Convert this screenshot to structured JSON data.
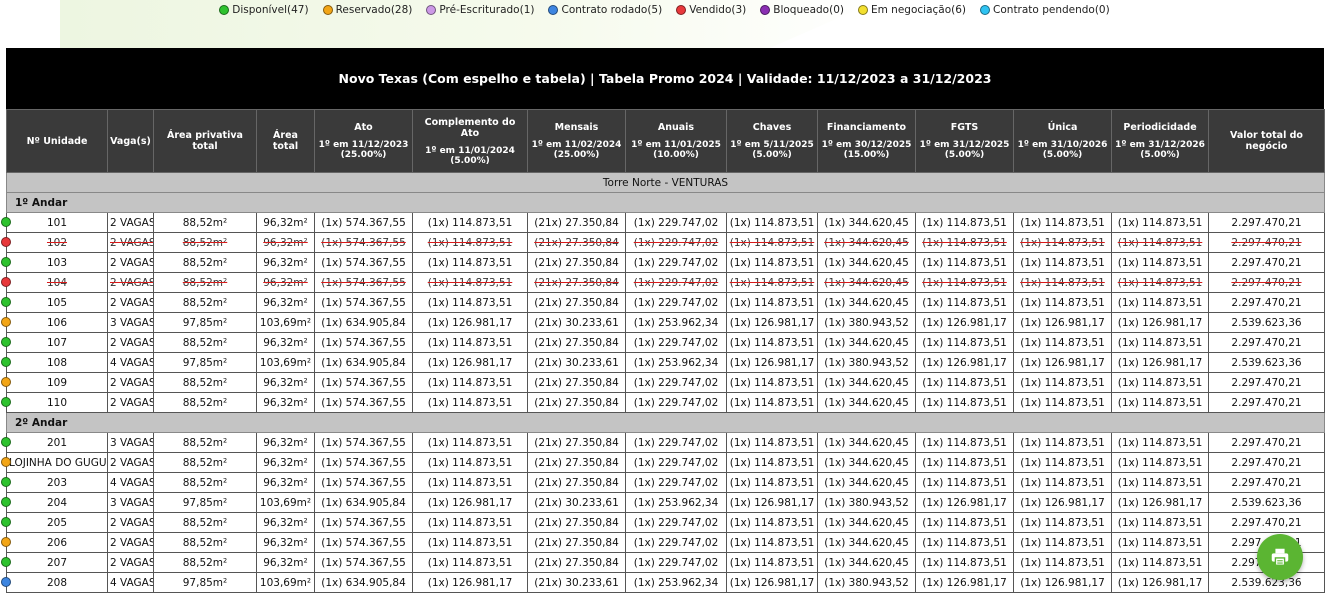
{
  "legend": [
    {
      "label": "Disponível(47)",
      "color": "#2ec22e"
    },
    {
      "label": "Reservado(28)",
      "color": "#f2a516"
    },
    {
      "label": "Pré-Escriturado(1)",
      "color": "#cc99e6"
    },
    {
      "label": "Contrato rodado(5)",
      "color": "#3d85e0"
    },
    {
      "label": "Vendido(3)",
      "color": "#e8383b"
    },
    {
      "label": "Bloqueado(0)",
      "color": "#8a2fb3"
    },
    {
      "label": "Em negociação(6)",
      "color": "#f2df2f"
    },
    {
      "label": "Contrato pendendo(0)",
      "color": "#2fc3f2"
    }
  ],
  "title": "Novo Texas (Com espelho e tabela) | Tabela Promo 2024 | Validade: 11/12/2023 a 31/12/2023",
  "columns": [
    {
      "label": "Nº Unidade",
      "sub": ""
    },
    {
      "label": "Vaga(s)",
      "sub": ""
    },
    {
      "label": "Área privativa total",
      "sub": ""
    },
    {
      "label": "Área total",
      "sub": ""
    },
    {
      "label": "Ato",
      "sub": "1º em 11/12/2023 (25.00%)"
    },
    {
      "label": "Complemento do Ato",
      "sub": "1º em 11/01/2024 (5.00%)"
    },
    {
      "label": "Mensais",
      "sub": "1º em 11/02/2024 (25.00%)"
    },
    {
      "label": "Anuais",
      "sub": "1º em 11/01/2025 (10.00%)"
    },
    {
      "label": "Chaves",
      "sub": "1º em 5/11/2025 (5.00%)"
    },
    {
      "label": "Financiamento",
      "sub": "1º em 30/12/2025 (15.00%)"
    },
    {
      "label": "FGTS",
      "sub": "1º em 31/12/2025 (5.00%)"
    },
    {
      "label": "Única",
      "sub": "1º em 31/10/2026 (5.00%)"
    },
    {
      "label": "Periodicidade",
      "sub": "1º em 31/12/2026 (5.00%)"
    },
    {
      "label": "Valor total do negócio",
      "sub": ""
    }
  ],
  "tower": "Torre Norte - VENTURAS",
  "floors": [
    {
      "label": "1º Andar",
      "units": [
        {
          "status": "disponivel",
          "cells": [
            "101",
            "2 VAGAS",
            "88,52m²",
            "96,32m²",
            "(1x) 574.367,55",
            "(1x) 114.873,51",
            "(21x) 27.350,84",
            "(1x) 229.747,02",
            "(1x) 114.873,51",
            "(1x) 344.620,45",
            "(1x) 114.873,51",
            "(1x) 114.873,51",
            "(1x) 114.873,51",
            "2.297.470,21"
          ]
        },
        {
          "status": "vendido",
          "cells": [
            "102",
            "2 VAGAS",
            "88,52m²",
            "96,32m²",
            "(1x) 574.367,55",
            "(1x) 114.873,51",
            "(21x) 27.350,84",
            "(1x) 229.747,02",
            "(1x) 114.873,51",
            "(1x) 344.620,45",
            "(1x) 114.873,51",
            "(1x) 114.873,51",
            "(1x) 114.873,51",
            "2.297.470,21"
          ]
        },
        {
          "status": "disponivel",
          "cells": [
            "103",
            "2 VAGAS",
            "88,52m²",
            "96,32m²",
            "(1x) 574.367,55",
            "(1x) 114.873,51",
            "(21x) 27.350,84",
            "(1x) 229.747,02",
            "(1x) 114.873,51",
            "(1x) 344.620,45",
            "(1x) 114.873,51",
            "(1x) 114.873,51",
            "(1x) 114.873,51",
            "2.297.470,21"
          ]
        },
        {
          "status": "vendido",
          "cells": [
            "104",
            "2 VAGAS",
            "88,52m²",
            "96,32m²",
            "(1x) 574.367,55",
            "(1x) 114.873,51",
            "(21x) 27.350,84",
            "(1x) 229.747,02",
            "(1x) 114.873,51",
            "(1x) 344.620,45",
            "(1x) 114.873,51",
            "(1x) 114.873,51",
            "(1x) 114.873,51",
            "2.297.470,21"
          ]
        },
        {
          "status": "disponivel",
          "cells": [
            "105",
            "2 VAGAS",
            "88,52m²",
            "96,32m²",
            "(1x) 574.367,55",
            "(1x) 114.873,51",
            "(21x) 27.350,84",
            "(1x) 229.747,02",
            "(1x) 114.873,51",
            "(1x) 344.620,45",
            "(1x) 114.873,51",
            "(1x) 114.873,51",
            "(1x) 114.873,51",
            "2.297.470,21"
          ]
        },
        {
          "status": "reservado",
          "cells": [
            "106",
            "3 VAGAS",
            "97,85m²",
            "103,69m²",
            "(1x) 634.905,84",
            "(1x) 126.981,17",
            "(21x) 30.233,61",
            "(1x) 253.962,34",
            "(1x) 126.981,17",
            "(1x) 380.943,52",
            "(1x) 126.981,17",
            "(1x) 126.981,17",
            "(1x) 126.981,17",
            "2.539.623,36"
          ]
        },
        {
          "status": "disponivel",
          "cells": [
            "107",
            "2 VAGAS",
            "88,52m²",
            "96,32m²",
            "(1x) 574.367,55",
            "(1x) 114.873,51",
            "(21x) 27.350,84",
            "(1x) 229.747,02",
            "(1x) 114.873,51",
            "(1x) 344.620,45",
            "(1x) 114.873,51",
            "(1x) 114.873,51",
            "(1x) 114.873,51",
            "2.297.470,21"
          ]
        },
        {
          "status": "disponivel",
          "cells": [
            "108",
            "4 VAGAS",
            "97,85m²",
            "103,69m²",
            "(1x) 634.905,84",
            "(1x) 126.981,17",
            "(21x) 30.233,61",
            "(1x) 253.962,34",
            "(1x) 126.981,17",
            "(1x) 380.943,52",
            "(1x) 126.981,17",
            "(1x) 126.981,17",
            "(1x) 126.981,17",
            "2.539.623,36"
          ]
        },
        {
          "status": "reservado",
          "cells": [
            "109",
            "2 VAGAS",
            "88,52m²",
            "96,32m²",
            "(1x) 574.367,55",
            "(1x) 114.873,51",
            "(21x) 27.350,84",
            "(1x) 229.747,02",
            "(1x) 114.873,51",
            "(1x) 344.620,45",
            "(1x) 114.873,51",
            "(1x) 114.873,51",
            "(1x) 114.873,51",
            "2.297.470,21"
          ]
        },
        {
          "status": "disponivel",
          "cells": [
            "110",
            "2 VAGAS",
            "88,52m²",
            "96,32m²",
            "(1x) 574.367,55",
            "(1x) 114.873,51",
            "(21x) 27.350,84",
            "(1x) 229.747,02",
            "(1x) 114.873,51",
            "(1x) 344.620,45",
            "(1x) 114.873,51",
            "(1x) 114.873,51",
            "(1x) 114.873,51",
            "2.297.470,21"
          ]
        }
      ]
    },
    {
      "label": "2º Andar",
      "units": [
        {
          "status": "disponivel",
          "cells": [
            "201",
            "3 VAGAS",
            "88,52m²",
            "96,32m²",
            "(1x) 574.367,55",
            "(1x) 114.873,51",
            "(21x) 27.350,84",
            "(1x) 229.747,02",
            "(1x) 114.873,51",
            "(1x) 344.620,45",
            "(1x) 114.873,51",
            "(1x) 114.873,51",
            "(1x) 114.873,51",
            "2.297.470,21"
          ]
        },
        {
          "status": "reservado",
          "cells": [
            "LOJINHA DO GUGU",
            "2 VAGAS",
            "88,52m²",
            "96,32m²",
            "(1x) 574.367,55",
            "(1x) 114.873,51",
            "(21x) 27.350,84",
            "(1x) 229.747,02",
            "(1x) 114.873,51",
            "(1x) 344.620,45",
            "(1x) 114.873,51",
            "(1x) 114.873,51",
            "(1x) 114.873,51",
            "2.297.470,21"
          ]
        },
        {
          "status": "disponivel",
          "cells": [
            "203",
            "4 VAGAS",
            "88,52m²",
            "96,32m²",
            "(1x) 574.367,55",
            "(1x) 114.873,51",
            "(21x) 27.350,84",
            "(1x) 229.747,02",
            "(1x) 114.873,51",
            "(1x) 344.620,45",
            "(1x) 114.873,51",
            "(1x) 114.873,51",
            "(1x) 114.873,51",
            "2.297.470,21"
          ]
        },
        {
          "status": "disponivel",
          "cells": [
            "204",
            "3 VAGAS",
            "97,85m²",
            "103,69m²",
            "(1x) 634.905,84",
            "(1x) 126.981,17",
            "(21x) 30.233,61",
            "(1x) 253.962,34",
            "(1x) 126.981,17",
            "(1x) 380.943,52",
            "(1x) 126.981,17",
            "(1x) 126.981,17",
            "(1x) 126.981,17",
            "2.539.623,36"
          ]
        },
        {
          "status": "disponivel",
          "cells": [
            "205",
            "2 VAGAS",
            "88,52m²",
            "96,32m²",
            "(1x) 574.367,55",
            "(1x) 114.873,51",
            "(21x) 27.350,84",
            "(1x) 229.747,02",
            "(1x) 114.873,51",
            "(1x) 344.620,45",
            "(1x) 114.873,51",
            "(1x) 114.873,51",
            "(1x) 114.873,51",
            "2.297.470,21"
          ]
        },
        {
          "status": "reservado",
          "cells": [
            "206",
            "2 VAGAS",
            "88,52m²",
            "96,32m²",
            "(1x) 574.367,55",
            "(1x) 114.873,51",
            "(21x) 27.350,84",
            "(1x) 229.747,02",
            "(1x) 114.873,51",
            "(1x) 344.620,45",
            "(1x) 114.873,51",
            "(1x) 114.873,51",
            "(1x) 114.873,51",
            "2.297.470,21"
          ]
        },
        {
          "status": "disponivel",
          "cells": [
            "207",
            "2 VAGAS",
            "88,52m²",
            "96,32m²",
            "(1x) 574.367,55",
            "(1x) 114.873,51",
            "(21x) 27.350,84",
            "(1x) 229.747,02",
            "(1x) 114.873,51",
            "(1x) 344.620,45",
            "(1x) 114.873,51",
            "(1x) 114.873,51",
            "(1x) 114.873,51",
            "2.297.470,21"
          ]
        },
        {
          "status": "contrato_rodado",
          "cells": [
            "208",
            "4 VAGAS",
            "97,85m²",
            "103,69m²",
            "(1x) 634.905,84",
            "(1x) 126.981,17",
            "(21x) 30.233,61",
            "(1x) 253.962,34",
            "(1x) 126.981,17",
            "(1x) 380.943,52",
            "(1x) 126.981,17",
            "(1x) 126.981,17",
            "(1x) 126.981,17",
            "2.539.623,36"
          ]
        }
      ]
    }
  ],
  "status_colors": {
    "disponivel": "#2ec22e",
    "reservado": "#f2a516",
    "vendido": "#e8383b",
    "contrato_rodado": "#3d85e0"
  },
  "print_button": {
    "icon": "printer-icon",
    "color": "#5bb532"
  }
}
